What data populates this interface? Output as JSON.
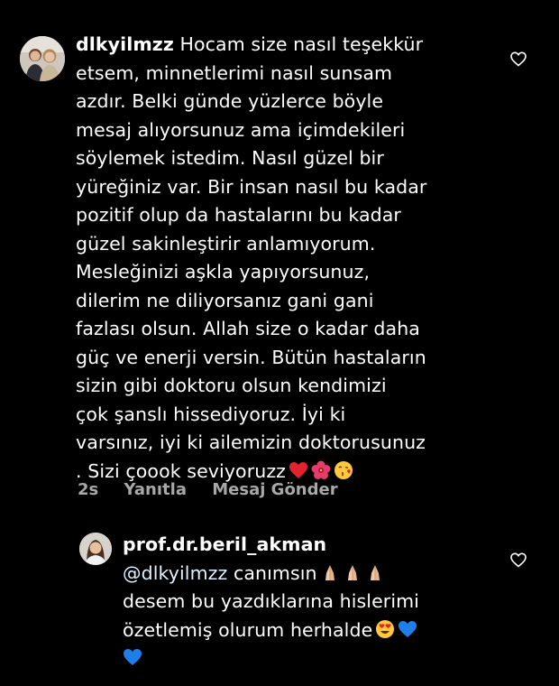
{
  "comment": {
    "username": "dlkyilmzz",
    "lines": [
      "Hocam size nasıl teşekkür",
      "etsem, minnetlerimi nasıl sunsam",
      "azdır. Belki günde yüzlerce böyle",
      "mesaj alıyorsunuz ama içimdekileri",
      "söylemek istedim. Nasıl güzel bir",
      "yüreğiniz var. Bir insan nasıl bu kadar",
      "pozitif olup da hastalarını bu kadar",
      "güzel sakinleştirir anlamıyorum.",
      "Mesleğinizi aşkla yapıyorsunuz,",
      "dilerim ne diliyorsanız gani gani",
      "fazlası olsun. Allah size o kadar daha",
      "güç ve enerji versin. Bütün hastaların",
      "sizin gibi doktoru olsun kendimizi",
      "çok şanslı hissediyoruz. İyi ki",
      "varsınız, iyi ki ailemizin doktorusunuz",
      ". Sizi çoook seviyoruzz"
    ],
    "emojis": [
      "red-heart",
      "hibiscus",
      "face-blowing-kiss"
    ],
    "time": "2s",
    "reply_label": "Yanıtla",
    "message_label": "Mesaj Gönder"
  },
  "reply": {
    "username": "prof.dr.beril_akman",
    "mention": "@dlkyilmzz",
    "line1_text": " canımsın",
    "line2": "desem bu yazdıklarına hislerimi",
    "line3": "özetlemiş olurum herhalde",
    "emojis_line1": [
      "folded-hands",
      "folded-hands",
      "folded-hands"
    ],
    "emojis_line3": [
      "heart-eyes-face",
      "blue-heart"
    ],
    "emojis_line4": [
      "blue-heart"
    ]
  },
  "colors": {
    "background": "#000000",
    "text": "#ffffff",
    "meta": "#a8a8a8",
    "mention": "#e0f1ff"
  }
}
